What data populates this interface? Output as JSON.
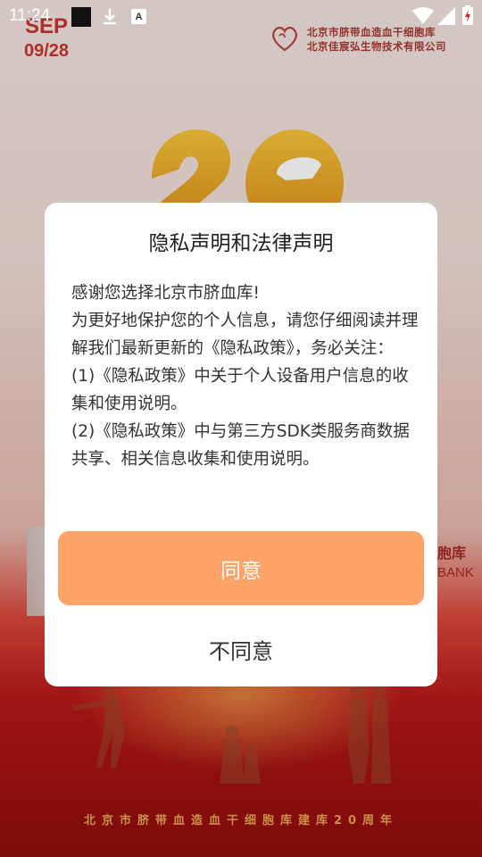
{
  "status_bar": {
    "time": "11:24",
    "icons": [
      "app-square-icon",
      "download-icon",
      "font-a-icon",
      "wifi-icon",
      "signal-icon",
      "battery-charging-icon"
    ],
    "font_icon_letter": "A"
  },
  "splash": {
    "month": "SEP",
    "day": "09/28",
    "org_name_line1": "北京市脐带血造血干细胞库",
    "org_name_line2": "北京佳宸弘生物技术有限公司",
    "bank_cn": "胞库",
    "bank_en": "BANK",
    "anniversary_text": "北京市脐带血造血干细胞库建库20周年"
  },
  "dialog": {
    "title": "隐私声明和法律声明",
    "paragraphs": [
      "感谢您选择北京市脐血库!",
      "为更好地保护您的个人信息，请您仔细阅读并理解我们最新更新的《隐私政策》，务必关注：",
      "(1)《隐私政策》中关于个人设备用户信息的收集和使用说明。",
      "(2)《隐私政策》中与第三方SDK类服务商数据共享、相关信息收集和使用说明。"
    ],
    "agree_label": "同意",
    "disagree_label": "不同意"
  },
  "colors": {
    "accent_button": "#ffa469",
    "brand_red": "#c8342c",
    "dialog_bg": "#ffffff"
  }
}
